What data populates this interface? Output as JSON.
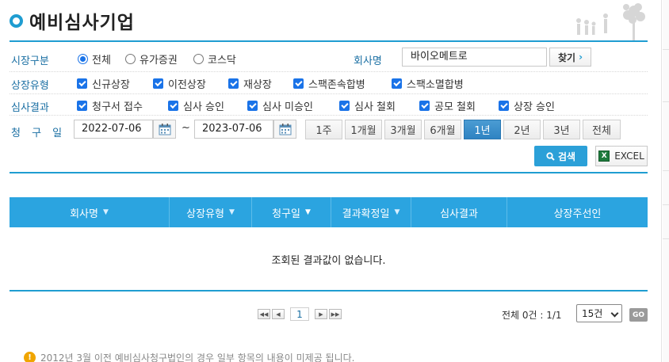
{
  "title": "예비심사기업",
  "labels": {
    "market": "시장구분",
    "company": "회사명",
    "listing_type": "상장유형",
    "result": "심사결과",
    "request_date": "청 구 일"
  },
  "market_options": [
    {
      "label": "전체",
      "checked": true
    },
    {
      "label": "유가증권",
      "checked": false
    },
    {
      "label": "코스닥",
      "checked": false
    }
  ],
  "company": {
    "value": "바이오메트로",
    "find_label": "찾기"
  },
  "listing_types": [
    {
      "label": "신규상장",
      "checked": true
    },
    {
      "label": "이전상장",
      "checked": true
    },
    {
      "label": "재상장",
      "checked": true
    },
    {
      "label": "스팩존속합병",
      "checked": true
    },
    {
      "label": "스팩소멸합병",
      "checked": true
    }
  ],
  "results": [
    {
      "label": "청구서 접수",
      "checked": true
    },
    {
      "label": "심사 승인",
      "checked": true
    },
    {
      "label": "심사 미승인",
      "checked": true
    },
    {
      "label": "심사 철회",
      "checked": true
    },
    {
      "label": "공모 철회",
      "checked": true
    },
    {
      "label": "상장 승인",
      "checked": true
    }
  ],
  "dates": {
    "from": "2022-07-06",
    "to": "2023-07-06",
    "separator": "~"
  },
  "periods": [
    {
      "label": "1주",
      "active": false
    },
    {
      "label": "1개월",
      "active": false
    },
    {
      "label": "3개월",
      "active": false
    },
    {
      "label": "6개월",
      "active": false
    },
    {
      "label": "1년",
      "active": true
    },
    {
      "label": "2년",
      "active": false
    },
    {
      "label": "3년",
      "active": false
    },
    {
      "label": "전체",
      "active": false
    }
  ],
  "actions": {
    "search_label": "검색",
    "excel_label": "EXCEL",
    "excel_icon_text": "X"
  },
  "table": {
    "columns": [
      {
        "label": "회사명",
        "sortable": true
      },
      {
        "label": "상장유형",
        "sortable": true
      },
      {
        "label": "청구일",
        "sortable": true
      },
      {
        "label": "결과확정일",
        "sortable": true
      },
      {
        "label": "심사결과",
        "sortable": false
      },
      {
        "label": "상장주선인",
        "sortable": false
      }
    ],
    "empty_message": "조회된 결과값이 없습니다."
  },
  "pagination": {
    "current_page": "1",
    "summary": "전체 0건 : 1/1",
    "page_size": "15건",
    "go_label": "GO"
  },
  "notice": {
    "icon": "!",
    "text": "2012년 3월 이전 예비심사청구법인의 경우 일부 항목의 내용이 미제공 됩니다."
  },
  "colors": {
    "accent": "#1f9dd1",
    "header_bg": "#2ba4e0",
    "active_period": "#3a8bc9"
  }
}
